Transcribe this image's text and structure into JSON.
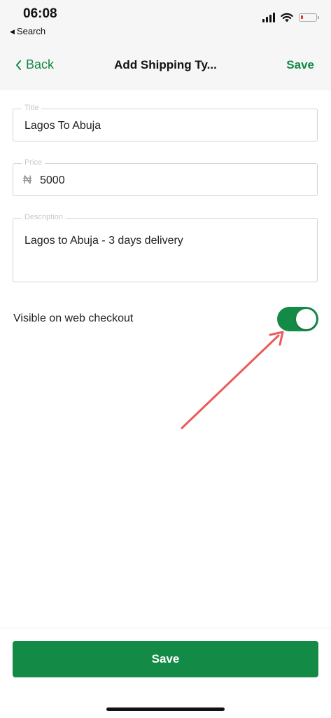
{
  "status_bar": {
    "time": "06:08",
    "back_app": "Search",
    "battery_color": "#e0322f"
  },
  "nav": {
    "back_label": "Back",
    "title": "Add Shipping Ty...",
    "save_label": "Save",
    "accent_color": "#118a46"
  },
  "form": {
    "title_label": "Title",
    "title_value": "Lagos To Abuja",
    "price_label": "Price",
    "currency_symbol": "₦",
    "price_value": "5000",
    "description_label": "Description",
    "description_value": "Lagos to Abuja - 3 days delivery"
  },
  "visibility": {
    "label": "Visible on web checkout",
    "enabled": true
  },
  "footer": {
    "save_label": "Save"
  },
  "icons": {
    "back_chevron": "chevron-left-icon",
    "signal": "cellular-signal-icon",
    "wifi": "wifi-icon",
    "battery": "battery-icon",
    "annotation": "red-arrow-annotation"
  }
}
